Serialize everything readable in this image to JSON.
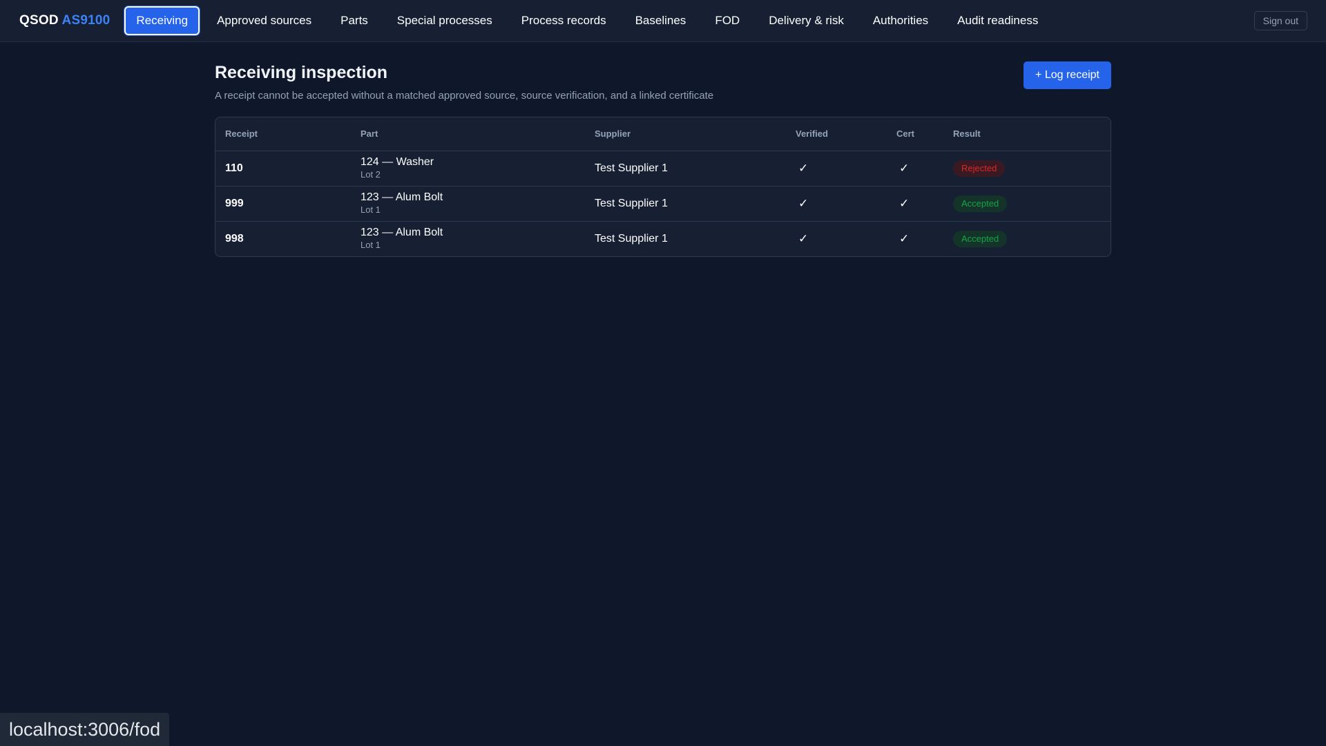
{
  "brand": {
    "name": "QSOD",
    "accent": "AS9100"
  },
  "nav": {
    "items": [
      {
        "label": "Receiving",
        "active": true
      },
      {
        "label": "Approved sources",
        "active": false
      },
      {
        "label": "Parts",
        "active": false
      },
      {
        "label": "Special processes",
        "active": false
      },
      {
        "label": "Process records",
        "active": false
      },
      {
        "label": "Baselines",
        "active": false
      },
      {
        "label": "FOD",
        "active": false
      },
      {
        "label": "Delivery & risk",
        "active": false
      },
      {
        "label": "Authorities",
        "active": false
      },
      {
        "label": "Audit readiness",
        "active": false
      }
    ],
    "signout_label": "Sign out"
  },
  "page": {
    "title": "Receiving inspection",
    "subtitle": "A receipt cannot be accepted without a matched approved source, source verification, and a linked certificate",
    "log_button_label": "+ Log receipt"
  },
  "table": {
    "headers": [
      "Receipt",
      "Part",
      "Supplier",
      "Verified",
      "Cert",
      "Result"
    ],
    "rows": [
      {
        "receipt": "110",
        "part": "124 — Washer",
        "lot": "Lot 2",
        "supplier": "Test Supplier 1",
        "verified": "✓",
        "cert": "✓",
        "result": "Rejected",
        "status": "rejected"
      },
      {
        "receipt": "999",
        "part": "123 — Alum Bolt",
        "lot": "Lot 1",
        "supplier": "Test Supplier 1",
        "verified": "✓",
        "cert": "✓",
        "result": "Accepted",
        "status": "accepted"
      },
      {
        "receipt": "998",
        "part": "123 — Alum Bolt",
        "lot": "Lot 1",
        "supplier": "Test Supplier 1",
        "verified": "✓",
        "cert": "✓",
        "result": "Accepted",
        "status": "accepted"
      }
    ]
  },
  "statusbar": {
    "url": "localhost:3006/fod"
  },
  "colors": {
    "background": "#0f172a",
    "accent": "#2563eb",
    "rejected": "#dc2626",
    "accepted": "#16a34a"
  }
}
